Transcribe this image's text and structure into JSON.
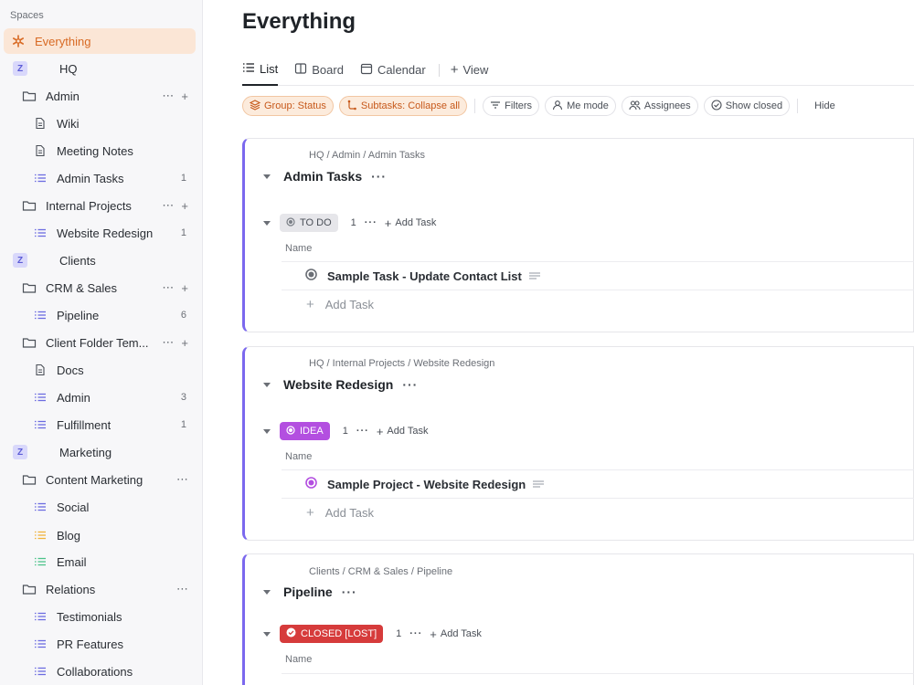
{
  "sidebar": {
    "header": "Spaces",
    "everything": "Everything",
    "items": [
      {
        "label": "HQ"
      },
      {
        "label": "Admin"
      },
      {
        "label": "Wiki"
      },
      {
        "label": "Meeting Notes"
      },
      {
        "label": "Admin Tasks",
        "count": "1"
      },
      {
        "label": "Internal Projects"
      },
      {
        "label": "Website Redesign",
        "count": "1"
      },
      {
        "label": "Clients"
      },
      {
        "label": "CRM & Sales"
      },
      {
        "label": "Pipeline",
        "count": "6"
      },
      {
        "label": "Client Folder Tem..."
      },
      {
        "label": "Docs"
      },
      {
        "label": "Admin",
        "count": "3"
      },
      {
        "label": "Fulfillment",
        "count": "1"
      },
      {
        "label": "Marketing"
      },
      {
        "label": "Content Marketing"
      },
      {
        "label": "Social"
      },
      {
        "label": "Blog"
      },
      {
        "label": "Email"
      },
      {
        "label": "Relations"
      },
      {
        "label": "Testimonials"
      },
      {
        "label": "PR Features"
      },
      {
        "label": "Collaborations"
      }
    ],
    "space_badge": "Z"
  },
  "main": {
    "title": "Everything",
    "tabs": {
      "list": "List",
      "board": "Board",
      "calendar": "Calendar",
      "view": "View"
    },
    "toolbar": {
      "group": "Group: Status",
      "subtasks": "Subtasks: Collapse all",
      "filters": "Filters",
      "me_mode": "Me mode",
      "assignees": "Assignees",
      "show_closed": "Show closed",
      "hide": "Hide"
    },
    "groups": [
      {
        "path": "HQ / Admin / Admin Tasks",
        "title": "Admin Tasks",
        "status": "TO DO",
        "count": "1",
        "add_task": "Add Task",
        "col_name": "Name",
        "task": "Sample Task - Update Contact List",
        "add_task_row": "Add Task"
      },
      {
        "path": "HQ / Internal Projects / Website Redesign",
        "title": "Website Redesign",
        "status": "IDEA",
        "count": "1",
        "add_task": "Add Task",
        "col_name": "Name",
        "task": "Sample Project - Website Redesign",
        "add_task_row": "Add Task"
      },
      {
        "path": "Clients / CRM & Sales / Pipeline",
        "title": "Pipeline",
        "status": "CLOSED [LOST]",
        "count": "1",
        "add_task": "Add Task",
        "col_name": "Name"
      }
    ],
    "colors": {
      "accent": "#7b68ee",
      "orange": "#d86a24",
      "idea": "#b34fe0",
      "lost": "#d63b3b",
      "todo": "#e6e6ea"
    }
  }
}
